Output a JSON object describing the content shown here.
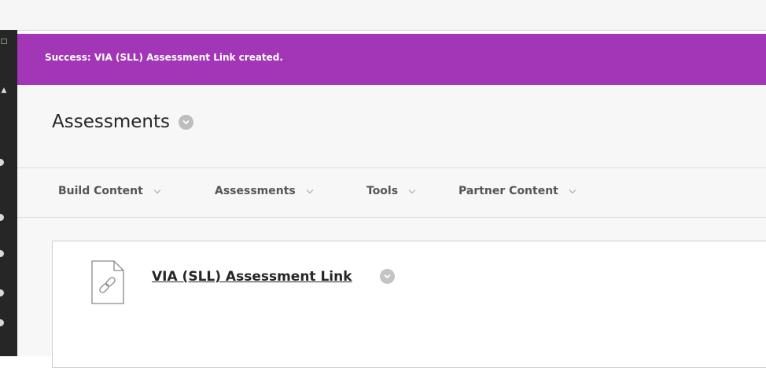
{
  "banner": {
    "message": "Success: VIA (SLL) Assessment Link created."
  },
  "page": {
    "title": "Assessments"
  },
  "action_bar": {
    "items": [
      {
        "label": "Build Content"
      },
      {
        "label": "Assessments"
      },
      {
        "label": "Tools"
      },
      {
        "label": "Partner Content"
      }
    ]
  },
  "content_item": {
    "title": "VIA (SLL) Assessment Link",
    "icon": "link-file-icon"
  },
  "colors": {
    "banner": "#a236b6",
    "rail": "#262626",
    "background": "#f7f7f7"
  }
}
